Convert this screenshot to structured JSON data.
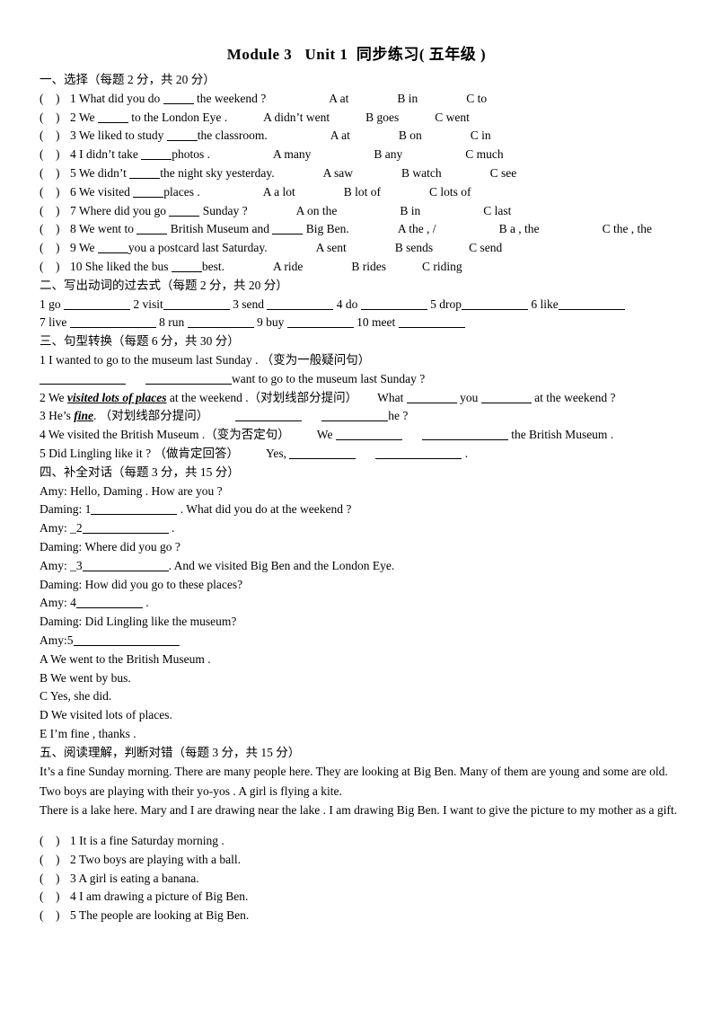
{
  "document": {
    "title": "Module 3   Unit 1  同步练习( 五年级 )"
  },
  "section1": {
    "heading": "一、选择（每题 2 分，共 20 分）",
    "questions": [
      {
        "num": "1",
        "stem_a": "What did you do",
        "stem_b": "the weekend ?",
        "a": "A at",
        "b": "B in",
        "c": "C to"
      },
      {
        "num": "2",
        "stem_a": "We",
        "stem_b": "to the London Eye .",
        "a": "A didn’t went",
        "b": "B goes",
        "c": "C went"
      },
      {
        "num": "3",
        "stem_a": "We liked to study",
        "stem_b": "the classroom.",
        "a": "A at",
        "b": "B on",
        "c": "C in"
      },
      {
        "num": "4",
        "stem_a": "I didn’t take",
        "stem_b": "photos .",
        "a": "A many",
        "b": "B any",
        "c": "C much"
      },
      {
        "num": "5",
        "stem_a": "We didn’t",
        "stem_b": "the night sky yesterday.",
        "a": "A saw",
        "b": "B watch",
        "c": "C see"
      },
      {
        "num": "6",
        "stem_a": "We visited",
        "stem_b": "places .",
        "a": "A a lot",
        "b": "B lot of",
        "c": "C lots of"
      },
      {
        "num": "7",
        "stem_a": "Where did you go",
        "stem_b": "Sunday ?",
        "a": "A on the",
        "b": "B in",
        "c": "C last"
      },
      {
        "num": "8",
        "stem_a": "We went to",
        "stem_mid": "British Museum and",
        "stem_b": "Big Ben.",
        "a": "A the , /",
        "b": "B a , the",
        "c": "C the , the"
      },
      {
        "num": "9",
        "stem_a": "We",
        "stem_b": "you a postcard last Saturday.",
        "a": "A sent",
        "b": "B sends",
        "c": "C send"
      },
      {
        "num": "10",
        "stem_a": "She liked the bus",
        "stem_b": "best.",
        "a": "A ride",
        "b": "B rides",
        "c": "C riding"
      }
    ]
  },
  "section2": {
    "heading": "二、写出动词的过去式（每题 2 分，共 20 分）",
    "row1": [
      {
        "num": "1",
        "verb": "go"
      },
      {
        "num": "2",
        "verb": "visit"
      },
      {
        "num": "3",
        "verb": "send"
      },
      {
        "num": "4",
        "verb": "do"
      },
      {
        "num": "5",
        "verb": "drop"
      },
      {
        "num": "6",
        "verb": "like"
      }
    ],
    "row2": [
      {
        "num": "7",
        "verb": "live"
      },
      {
        "num": "8",
        "verb": "run"
      },
      {
        "num": "9",
        "verb": "buy"
      },
      {
        "num": "10",
        "verb": "meet"
      }
    ]
  },
  "section3": {
    "heading": "三、句型转换（每题 6 分，共 30 分）",
    "q1": {
      "text": "1 I wanted to go to the museum last Sunday . （变为一般疑问句）",
      "answer_tail": "want to go to the museum last Sunday ?"
    },
    "q2": {
      "pre": "2 We ",
      "emph": "visited lots of places",
      "post": " at the weekend .（对划线部分提问）",
      "ans_a": "What",
      "ans_b": "you",
      "ans_c": "at the weekend ?"
    },
    "q3": {
      "pre": "3 He’s ",
      "emph": "fine",
      "post": ". （对划线部分提问）",
      "ans_tail": "he ?"
    },
    "q4": {
      "pre": "4 We visited the British Museum .（变为否定句）",
      "ans_lead": "We",
      "ans_tail": "the British Museum ."
    },
    "q5": {
      "pre": "5 Did Lingling like it ? （做肯定回答）",
      "ans_lead": "Yes,",
      "ans_tail": "."
    }
  },
  "section4": {
    "heading": "四、补全对话（每题 3 分，共 15 分）",
    "dialogue": [
      {
        "speaker": "Amy:",
        "text": "Hello, Daming . How are you ?",
        "blank": null,
        "tail": null
      },
      {
        "speaker": "Daming:",
        "text": null,
        "blank": "1",
        "tail": ". What did you do at the weekend ?"
      },
      {
        "speaker": "Amy:",
        "text": null,
        "blank": "_2",
        "tail": "."
      },
      {
        "speaker": "Daming:",
        "text": "Where did you go ?",
        "blank": null,
        "tail": null
      },
      {
        "speaker": "Amy:",
        "text": null,
        "blank": "_3",
        "tail": ". And we visited Big Ben and the London Eye."
      },
      {
        "speaker": "Daming:",
        "text": "How did you go to these places?",
        "blank": null,
        "tail": null
      },
      {
        "speaker": "Amy:",
        "text": null,
        "blank": "4",
        "tail": "."
      },
      {
        "speaker": "Daming:",
        "text": "Did Lingling like the museum?",
        "blank": null,
        "tail": null
      },
      {
        "speaker": "Amy:",
        "text": null,
        "blank": "5",
        "tail": ""
      }
    ],
    "choices": [
      "A We went to the British Museum .",
      "B We went by bus.",
      "C Yes, she did.",
      "D We visited lots of places.",
      "E I’m fine , thanks ."
    ]
  },
  "section5": {
    "heading": "五、阅读理解，判断对错（每题 3 分，共 15 分）",
    "para1": "It’s a fine Sunday morning. There are many people here. They are looking at Big Ben. Many of them are young and some are old. Two boys are playing with their yo-yos . A girl is flying a kite.",
    "para2": "There is a lake here. Mary and I are drawing near the lake . I am drawing Big Ben. I want to give the picture to my mother as a gift.",
    "questions": [
      {
        "num": "1",
        "text": "It is a fine Saturday morning ."
      },
      {
        "num": "2",
        "text": "Two boys are playing with a ball."
      },
      {
        "num": "3",
        "text": "A girl is eating a banana."
      },
      {
        "num": "4",
        "text": "I am drawing a picture of Big Ben."
      },
      {
        "num": "5",
        "text": "The people are looking at Big Ben."
      }
    ]
  }
}
